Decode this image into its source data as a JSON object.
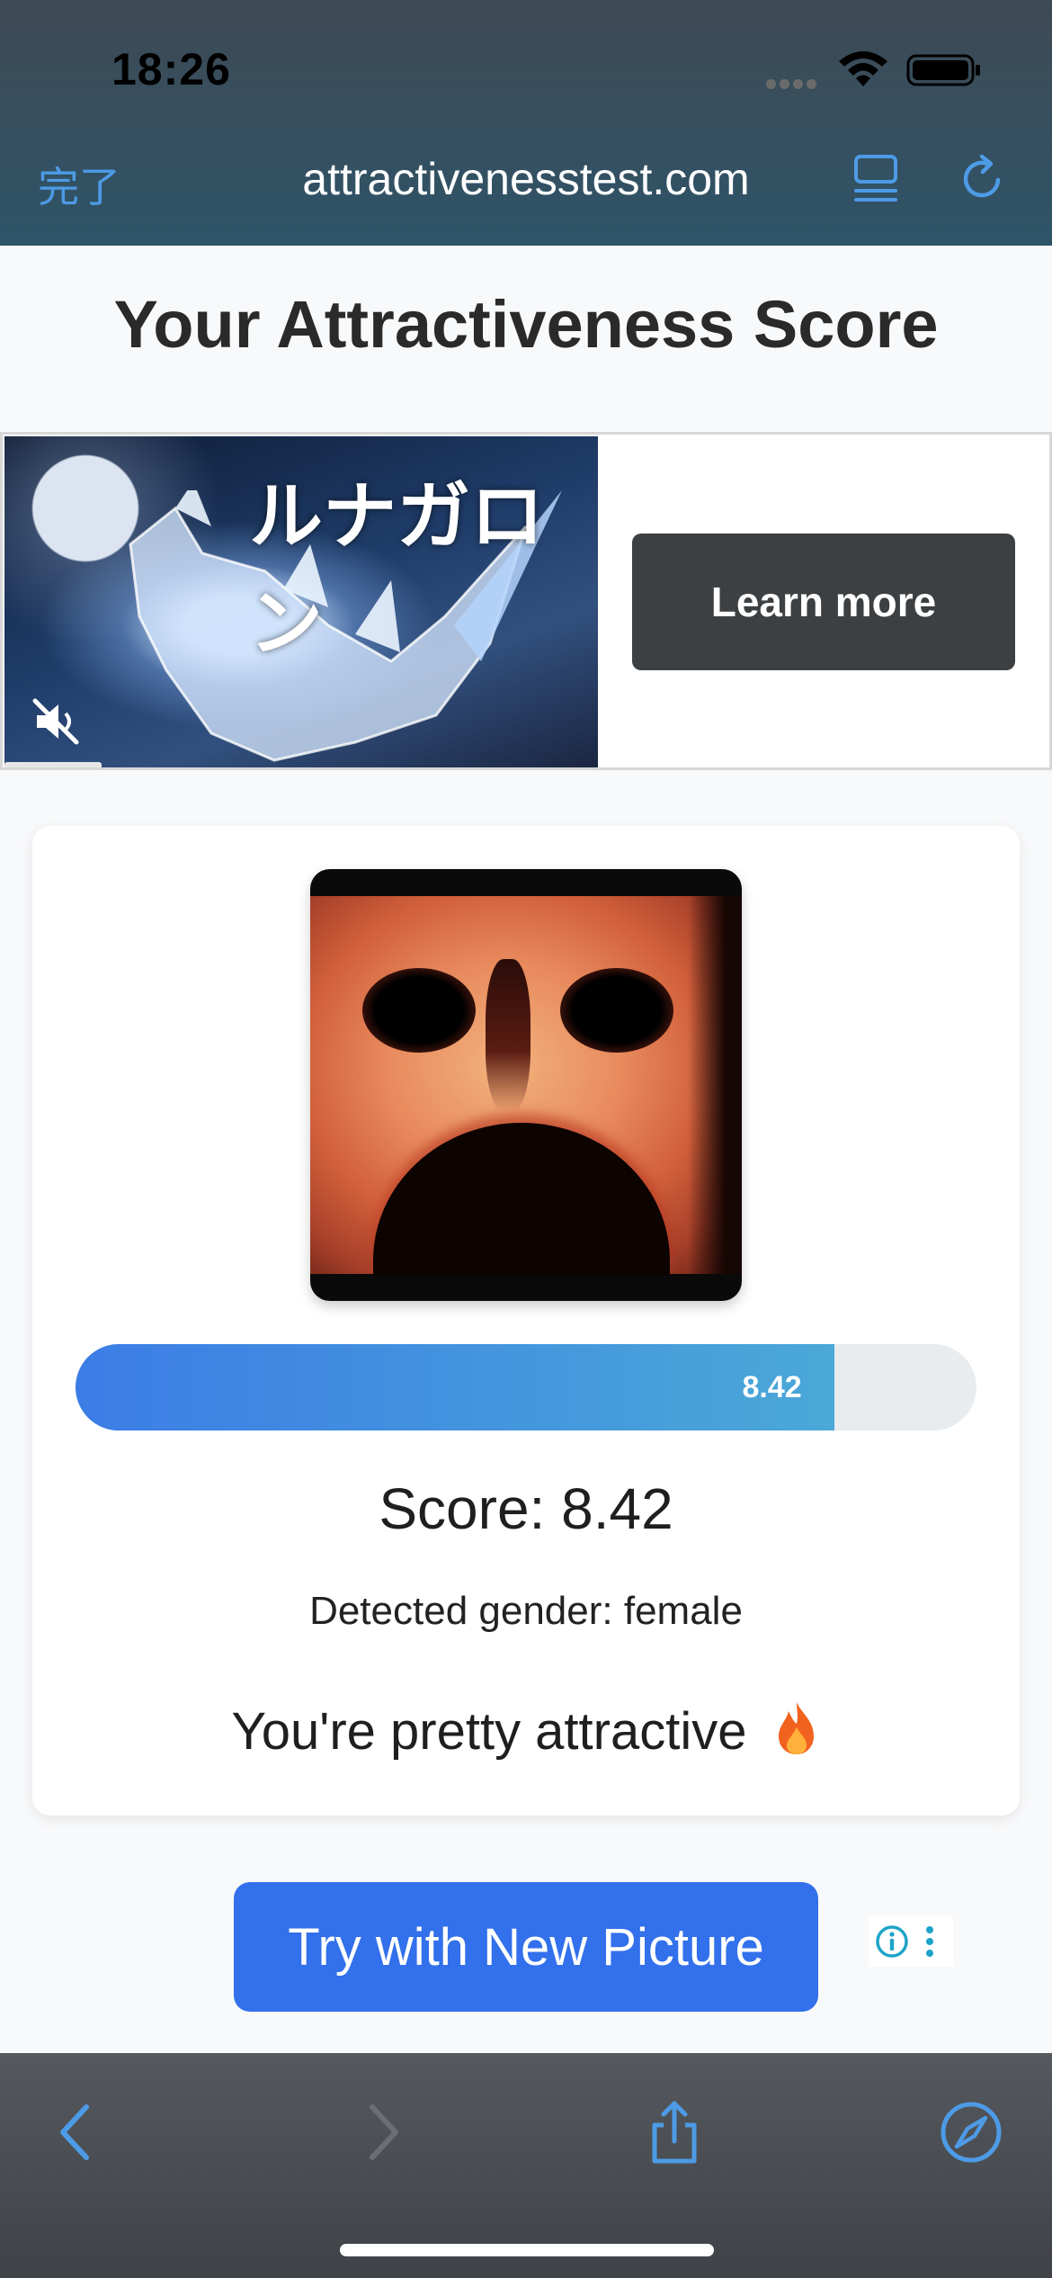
{
  "status_bar": {
    "time": "18:26",
    "icons": [
      "signal-dots-icon",
      "wifi-icon",
      "battery-icon"
    ]
  },
  "browser": {
    "done_label": "完了",
    "url": "attractivenesstest.com",
    "icons": [
      "reader-icon",
      "reload-icon"
    ],
    "toolbar_icons": [
      "back-icon",
      "forward-icon",
      "share-icon",
      "compass-icon"
    ]
  },
  "page": {
    "title": "Your Attractiveness Score"
  },
  "ad": {
    "image_text": "ルナガロン",
    "cta_label": "Learn more",
    "icons": [
      "mute-icon",
      "ad-info-icon",
      "ad-kebab-icon"
    ]
  },
  "result": {
    "score_value": "8.42",
    "score_fraction": 0.842,
    "score_label": "Score: 8.42",
    "gender_label": "Detected gender: female",
    "verdict": "You're pretty attractive",
    "verdict_icon": "fire-icon"
  },
  "actions": {
    "try_again_label": "Try with New Picture"
  },
  "colors": {
    "accent_blue": "#3270ec",
    "score_gradient_start": "#3b7de6",
    "score_gradient_end": "#4ba8d7",
    "link_blue": "#4d9be6"
  }
}
